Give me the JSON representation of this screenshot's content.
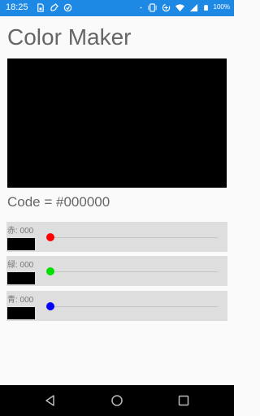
{
  "status_bar": {
    "time": "18:25",
    "battery": "100%",
    "icons_left": [
      "sim-card-icon",
      "phone-settings-icon",
      "sync-icon"
    ],
    "icons_right": [
      "dot-icon",
      "vibrate-icon",
      "data-saver-icon",
      "wifi-icon",
      "signal-icon",
      "battery-icon"
    ]
  },
  "app": {
    "title": "Color Maker",
    "code_label": "Code = #000000",
    "preview_color": "#000000"
  },
  "sliders": [
    {
      "label": "赤: 000",
      "value": 0,
      "thumb_color": "#ff0000",
      "swatch_color": "#000000"
    },
    {
      "label": "緑: 000",
      "value": 0,
      "thumb_color": "#00e000",
      "swatch_color": "#000000"
    },
    {
      "label": "青: 000",
      "value": 0,
      "thumb_color": "#0000ff",
      "swatch_color": "#000000"
    }
  ],
  "nav_bar": {
    "buttons": [
      "back-icon",
      "home-icon",
      "recent-apps-icon"
    ]
  },
  "colors": {
    "status_bar": "#1e88e5",
    "background": "#fafafa",
    "slider_row_bg": "#dedede"
  }
}
